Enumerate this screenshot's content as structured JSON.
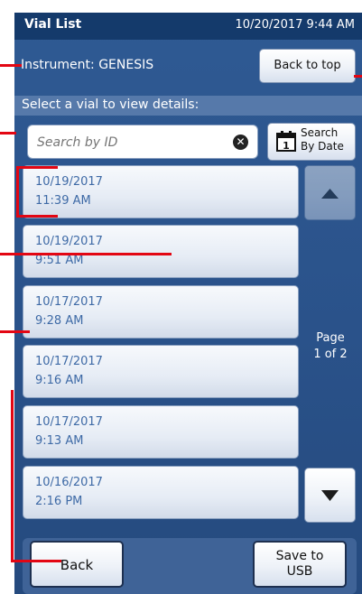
{
  "titlebar": {
    "title": "Vial List",
    "datetime": "10/20/2017 9:44 AM"
  },
  "instrument": {
    "label": "Instrument:",
    "name": "GENESIS"
  },
  "buttons": {
    "back_to_top": "Back to top",
    "search_by_date_line1": "Search",
    "search_by_date_line2": "By Date",
    "back": "Back",
    "save_line1": "Save to",
    "save_line2": "USB"
  },
  "prompt": "Select a vial to view details:",
  "search": {
    "placeholder": "Search by ID",
    "value": ""
  },
  "calendar_icon_digit": "1",
  "vials": [
    {
      "date": "10/19/2017",
      "time": "11:39 AM"
    },
    {
      "date": "10/19/2017",
      "time": "9:51 AM"
    },
    {
      "date": "10/17/2017",
      "time": "9:28 AM"
    },
    {
      "date": "10/17/2017",
      "time": "9:16 AM"
    },
    {
      "date": "10/17/2017",
      "time": "9:13 AM"
    },
    {
      "date": "10/16/2017",
      "time": "2:16 PM"
    }
  ],
  "pagination": {
    "label": "Page",
    "position": "1 of 2"
  },
  "colors": {
    "header": "#143a6b",
    "panel": "#2a528a",
    "vial_text": "#3e6aa6",
    "callout": "#e30613"
  },
  "icons": [
    "calendar-icon",
    "clear-search-icon",
    "scroll-up-arrow-icon",
    "scroll-down-arrow-icon"
  ]
}
